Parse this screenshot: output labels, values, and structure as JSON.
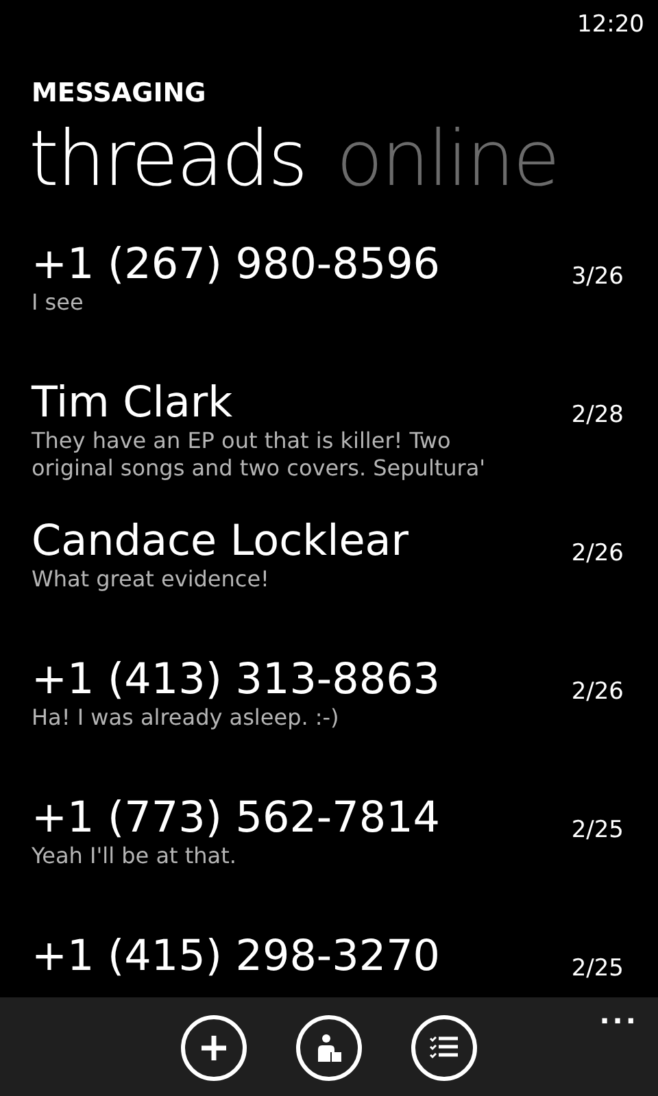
{
  "status_bar": {
    "time": "12:20"
  },
  "app_title": "MESSAGING",
  "pivot": [
    {
      "label": "threads",
      "selected": true
    },
    {
      "label": "online",
      "selected": false
    }
  ],
  "threads": [
    {
      "name": "+1 (267) 980-8596",
      "preview": "I see",
      "date": "3/26"
    },
    {
      "name": "Tim Clark",
      "preview": "They have an EP out that is killer! Two original songs and two covers. Sepultura'",
      "date": "2/28"
    },
    {
      "name": "Candace Locklear",
      "preview": "What great evidence!",
      "date": "2/26"
    },
    {
      "name": "+1 (413) 313-8863",
      "preview": "Ha! I was already asleep. :-)",
      "date": "2/26"
    },
    {
      "name": "+1 (773) 562-7814",
      "preview": "Yeah I'll be at that.",
      "date": "2/25"
    },
    {
      "name": "+1 (415) 298-3270",
      "date": "2/25"
    }
  ],
  "app_bar": {
    "buttons": [
      {
        "kind": "add"
      },
      {
        "kind": "contact"
      },
      {
        "kind": "select"
      }
    ],
    "more": "..."
  }
}
